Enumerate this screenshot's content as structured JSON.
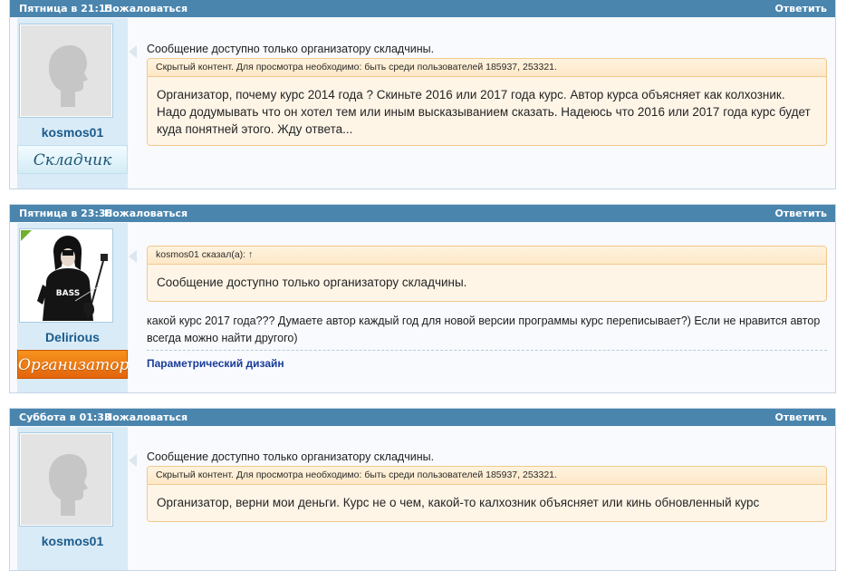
{
  "colors": {
    "bar": "#4a85ae",
    "user_column": "#d9ebf7",
    "quote_background": "#fef5e7",
    "quote_border": "#f3c98c",
    "rank_organizer": "#f7931e",
    "online": "#6fb12c",
    "signature_link": "#1a3c9a"
  },
  "posts": [
    {
      "date": "Пятница в 21:15",
      "complain": "Пожаловаться",
      "reply": "Ответить",
      "username": "kosmos01",
      "rank": "Складчик",
      "avatar": "default-silhouette-icon",
      "intro": "Сообщение доступно только организатору складчины.",
      "hidden_label": "Скрытый контент. Для просмотра необходимо: быть среди пользователей 185937, 253321.",
      "hidden_text": "Организатор, почему курс 2014 года ? Скиньте 2016 или 2017 года курс. Автор курса объясняет как колхозник. Надо додумывать что он хотел тем или иным высказыванием сказать. Надеюсь что 2016 или 2017 года курс будет куда понятней этого. Жду ответа..."
    },
    {
      "date": "Пятница в 23:38",
      "complain": "Пожаловаться",
      "reply": "Ответить",
      "username": "Delirious",
      "rank": "Организатор",
      "avatar": "bass-guitarist-photo",
      "quote_label": "kosmos01 сказал(а): ↑",
      "quote_text": "Сообщение доступно только организатору складчины.",
      "text": "какой курс 2017 года??? Думаете автор каждый год для новой версии программы курс переписывает?) Если не нравится автор всегда можно найти другого)",
      "signature": "Параметрический дизайн"
    },
    {
      "date": "Суббота в 01:33",
      "complain": "Пожаловаться",
      "reply": "Ответить",
      "username": "kosmos01",
      "avatar": "default-silhouette-icon",
      "intro": "Сообщение доступно только организатору складчины.",
      "hidden_label": "Скрытый контент. Для просмотра необходимо: быть среди пользователей 185937, 253321.",
      "hidden_text": "Организатор, верни мои деньги. Курс не о чем, какой-то калхозник объясняет или кинь обновленный курс"
    }
  ]
}
